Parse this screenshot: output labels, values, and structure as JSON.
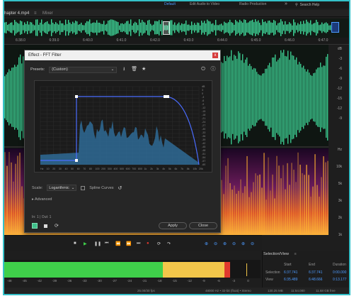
{
  "workspaces": [
    {
      "label": "Default",
      "active": true
    },
    {
      "label": "Edit Audio to Video",
      "active": false
    },
    {
      "label": "Radio Production",
      "active": false
    }
  ],
  "search_label": "Search Help",
  "file_tabs": [
    {
      "label": "hapter 4.mp4",
      "active": true
    },
    {
      "label": "Mixer",
      "active": false
    }
  ],
  "ruler_ticks": [
    "6:38.0",
    "6:39.0",
    "6:40.0",
    "6:41.0",
    "6:42.0",
    "6:43.0",
    "6:44.0",
    "6:45.0",
    "6:46.0",
    "6:47.0"
  ],
  "right_scale_top": [
    "dB",
    "-3",
    "-6",
    "-9",
    "-12",
    "-15",
    "-12",
    "-9"
  ],
  "right_scale_bottom": [
    "Hz",
    "10k",
    "5k",
    "3k",
    "2k",
    "1k"
  ],
  "dialog": {
    "title": "Effect - FFT Filter",
    "close": "x",
    "presets_label": "Presets:",
    "preset_value": "(Custom)",
    "scale_label": "Scale:",
    "scale_value": "Logarithmic",
    "spline_label": "Spline Curves",
    "advanced_label": "Advanced",
    "io_label": "In: 1 | Out: 1",
    "apply_label": "Apply",
    "close_label": "Close",
    "graph_db_labels": [
      "dB",
      "3",
      "0",
      "-3",
      "-6",
      "-9",
      "-12",
      "-15",
      "-18",
      "-21",
      "-24",
      "-27",
      "-30",
      "-33",
      "-36",
      "-39",
      "-42",
      "-45",
      "-48",
      "-51",
      "-54",
      "-57",
      "-60"
    ],
    "graph_hz_labels": [
      "Hz",
      "10",
      "20",
      "30",
      "40",
      "50",
      "60",
      "70",
      "80",
      "100",
      "200",
      "300",
      "400",
      "500",
      "600",
      "700",
      "800",
      "1k",
      "2k",
      "3k",
      "4k",
      "5k",
      "6k",
      "7k",
      "8k",
      "10k",
      "20k"
    ]
  },
  "selection_view": {
    "title": "Selection/View",
    "headers": [
      "Start",
      "End",
      "Duration"
    ],
    "rows": [
      {
        "label": "Selection",
        "start": "6:37.741",
        "end": "6:37.741",
        "duration": "0:00.000"
      },
      {
        "label": "View",
        "start": "6:35.489",
        "end": "6:48.666",
        "duration": "0:13.177"
      }
    ]
  },
  "meter_ticks": [
    "-48",
    "-45",
    "-42",
    "-39",
    "-36",
    "-33",
    "-30",
    "-27",
    "-24",
    "-21",
    "-18",
    "-15",
    "-12",
    "-9",
    "-6",
    "-3",
    "0"
  ],
  "meter_levels": {
    "green_end": 0.62,
    "yellow_end": 0.86,
    "red_end": 0.88
  },
  "status": [
    "25.00/30 fps",
    "48000 Hz • 32-bit (float) • Stereo",
    "130.25 MB",
    "11:54.080",
    "11.68 GB free"
  ],
  "colors": {
    "accent": "#35c0c8",
    "waveform": "#3fd89a",
    "selection": "#4d9bff"
  }
}
